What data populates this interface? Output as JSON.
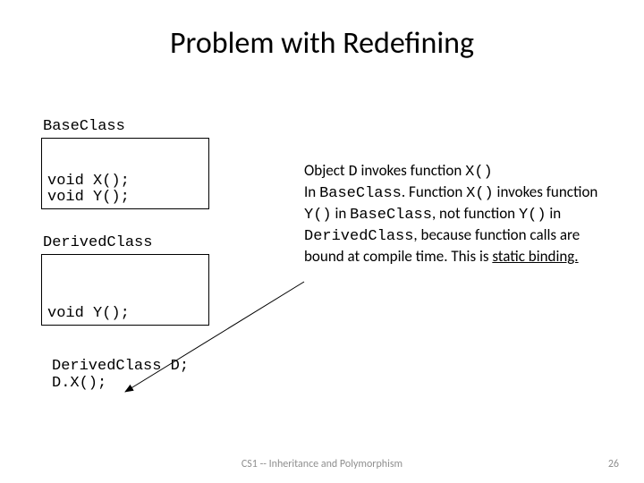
{
  "title": "Problem with Redefining",
  "base": {
    "label": "BaseClass",
    "methods": [
      "void X();",
      "void Y();"
    ]
  },
  "derived": {
    "label": "DerivedClass",
    "methods": [
      "void Y();"
    ]
  },
  "declaration": {
    "line1": "DerivedClass D;",
    "line2": "D.X();"
  },
  "body": {
    "p1a": "Object ",
    "p1b": "D",
    "p1c": " invokes function ",
    "p1d": "X()",
    "p2a": "In ",
    "p2b": "BaseClass",
    "p2c": ".  Function ",
    "p2d": "X()",
    "p2e": " invokes function ",
    "p2f": "Y()",
    "p2g": " in ",
    "p2h": "BaseClass",
    "p2i": ", not function ",
    "p2j": "Y()",
    "p2k": "  in ",
    "p2l": "DerivedClass",
    "p2m": ", because function calls are  bound at compile time.  This is ",
    "p2n": "static binding."
  },
  "footer": {
    "center": "CS1 -- Inheritance and Polymorphism",
    "page": "26"
  }
}
